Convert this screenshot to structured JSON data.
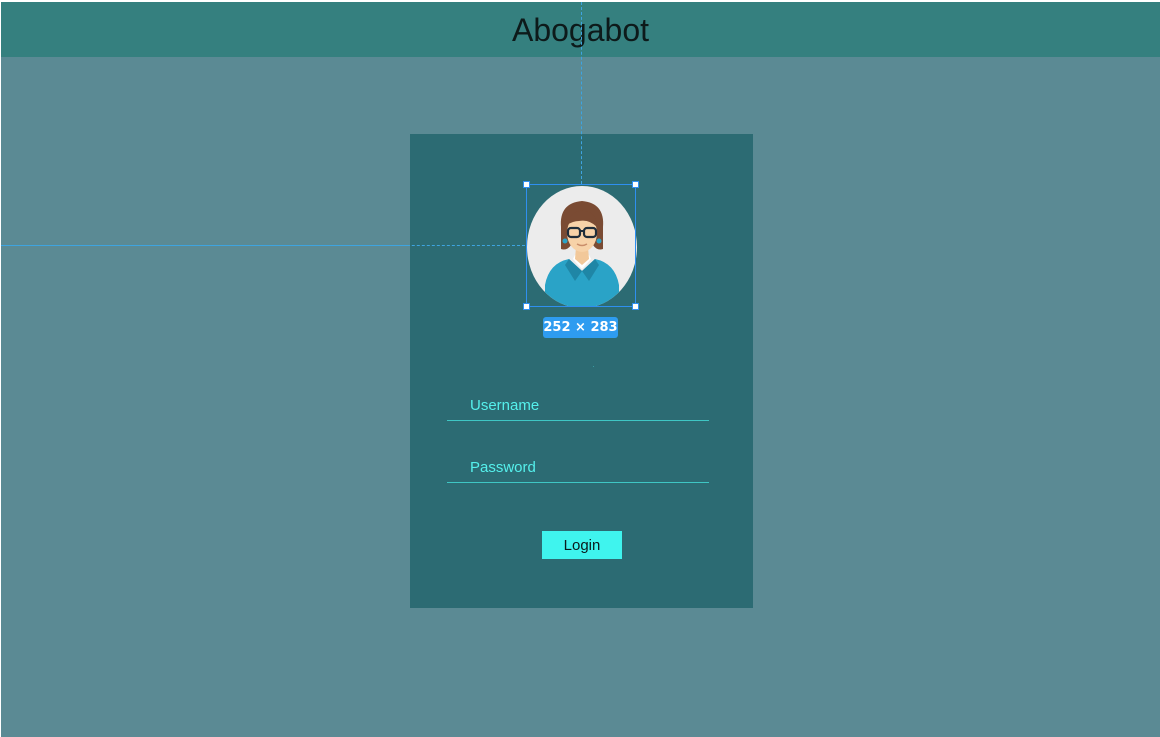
{
  "header": {
    "title": "Abogabot"
  },
  "avatar": {
    "icon": "female-user-avatar-icon",
    "selection_size_label": "252 × 283"
  },
  "login_form": {
    "username_placeholder": "Username",
    "username_value": "",
    "password_placeholder": "Password",
    "password_value": "",
    "login_label": "Login"
  },
  "colors": {
    "background": "#5b8a94",
    "header": "#35807f",
    "card": "#2c6b73",
    "accent": "#3ff4ee",
    "field_text": "#55f0ec",
    "selection": "#2f8ff0"
  }
}
